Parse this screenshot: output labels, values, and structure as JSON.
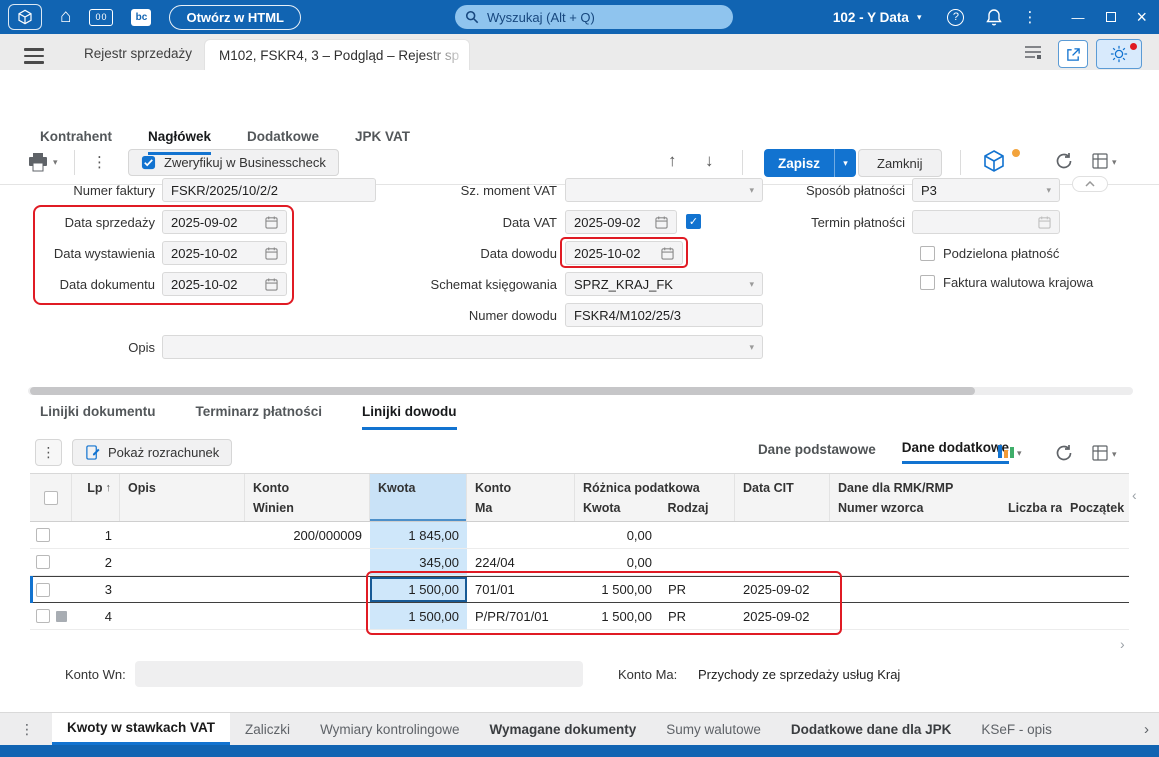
{
  "titlebar": {
    "open_html_button": "Otwórz w HTML",
    "search_placeholder": "Wyszukaj (Alt + Q)",
    "company_selector": "102 - Y Data"
  },
  "tab_bar": {
    "background_tab": "Rejestr sprzedaży",
    "active_tab": "M102, FSKR4, 3 – Podgląd – Rejestr sp"
  },
  "toolbar": {
    "verify_button": "Zweryfikuj w Businesscheck",
    "save_button": "Zapisz",
    "close_button": "Zamknij"
  },
  "form_tabs": {
    "items": [
      {
        "label": "Kontrahent"
      },
      {
        "label": "Nagłówek"
      },
      {
        "label": "Dodatkowe"
      },
      {
        "label": "JPK VAT"
      }
    ]
  },
  "form": {
    "numer_faktury": {
      "label": "Numer faktury",
      "value": "FSKR/2025/10/2/2"
    },
    "data_sprzedazy": {
      "label": "Data sprzedaży",
      "value": "2025-09-02"
    },
    "data_wystawienia": {
      "label": "Data wystawienia",
      "value": "2025-10-02"
    },
    "data_dokumentu": {
      "label": "Data dokumentu",
      "value": "2025-10-02"
    },
    "opis": {
      "label": "Opis",
      "value": ""
    },
    "sz_moment_vat": {
      "label": "Sz. moment VAT",
      "value": ""
    },
    "data_vat": {
      "label": "Data VAT",
      "value": "2025-09-02",
      "checked": true
    },
    "data_dowodu": {
      "label": "Data dowodu",
      "value": "2025-10-02"
    },
    "schemat_ksiegowania": {
      "label": "Schemat księgowania",
      "value": "SPRZ_KRAJ_FK"
    },
    "numer_dowodu": {
      "label": "Numer dowodu",
      "value": "FSKR4/M102/25/3"
    },
    "sposob_platnosci": {
      "label": "Sposób płatności",
      "value": "P3"
    },
    "termin_platnosci": {
      "label": "Termin płatności",
      "value": ""
    },
    "podzielona_platnosc": {
      "label": "Podzielona płatność",
      "checked": false
    },
    "faktura_walutowa": {
      "label": "Faktura walutowa krajowa",
      "checked": false
    }
  },
  "section_tabs": {
    "items": [
      {
        "label": "Linijki dokumentu"
      },
      {
        "label": "Terminarz płatności"
      },
      {
        "label": "Linijki dowodu"
      }
    ]
  },
  "grid_toolbar": {
    "show_settlement_button": "Pokaż rozrachunek",
    "view_basic": "Dane podstawowe",
    "view_additional": "Dane dodatkowe"
  },
  "grid": {
    "headers": {
      "lp": "Lp",
      "opis": "Opis",
      "konto_wn": "Konto",
      "winien": "Winien",
      "kwota": "Kwota",
      "konto_ma": "Konto",
      "ma": "Ma",
      "roznica_podatkowa": "Różnica podatkowa",
      "roznica_kwota": "Kwota",
      "roznica_rodzaj": "Rodzaj",
      "data_cit": "Data CIT",
      "rmk": "Dane dla RMK/RMP",
      "numer_wzorca": "Numer wzorca",
      "liczba_rat": "Liczba rat",
      "poczatek": "Początek"
    },
    "rows": [
      {
        "lp": "1",
        "opis": "",
        "winien": "200/000009",
        "kwota": "1 845,00",
        "ma": "",
        "roznica_kwota": "0,00",
        "rodzaj": "",
        "data_cit": "",
        "numer_wzorca": "",
        "liczba_rat": "",
        "poczatek": ""
      },
      {
        "lp": "2",
        "opis": "",
        "winien": "",
        "kwota": "345,00",
        "ma": "224/04",
        "roznica_kwota": "0,00",
        "rodzaj": "",
        "data_cit": "",
        "numer_wzorca": "",
        "liczba_rat": "",
        "poczatek": ""
      },
      {
        "lp": "3",
        "opis": "",
        "winien": "",
        "kwota": "1 500,00",
        "ma": "701/01",
        "roznica_kwota": "1 500,00",
        "rodzaj": "PR",
        "data_cit": "2025-09-02",
        "numer_wzorca": "",
        "liczba_rat": "",
        "poczatek": ""
      },
      {
        "lp": "4",
        "opis": "",
        "winien": "",
        "kwota": "1 500,00",
        "ma": "P/PR/701/01",
        "roznica_kwota": "1 500,00",
        "rodzaj": "PR",
        "data_cit": "2025-09-02",
        "numer_wzorca": "",
        "liczba_rat": "",
        "poczatek": ""
      }
    ]
  },
  "footer": {
    "konto_wn": {
      "label": "Konto Wn:",
      "value": ""
    },
    "konto_ma": {
      "label": "Konto Ma:",
      "value": "Przychody ze sprzedaży usług Kraj"
    }
  },
  "bottom_tabs": {
    "items": [
      {
        "label": "Kwoty w stawkach VAT"
      },
      {
        "label": "Zaliczki"
      },
      {
        "label": "Wymiary kontrolingowe"
      },
      {
        "label": "Wymagane dokumenty"
      },
      {
        "label": "Sumy walutowe"
      },
      {
        "label": "Dodatkowe dane dla JPK"
      },
      {
        "label": "KSeF - opis"
      }
    ]
  },
  "icons": {
    "caret_down": "▾",
    "kebab": "⋮",
    "home": "⌂",
    "help": "?",
    "minimize": "—",
    "close": "×",
    "arrow_up": "↑",
    "arrow_down": "↓",
    "sort_asc": "↑",
    "check": "✓",
    "chevron_left": "‹",
    "chevron_right": "›",
    "calc_label": "00",
    "bc_label": "bc"
  },
  "colors": {
    "topbar": "#1164b2",
    "accent": "#1273d0",
    "annotation_red": "#e01b24",
    "kwota_highlight": "#cfe7fa"
  }
}
